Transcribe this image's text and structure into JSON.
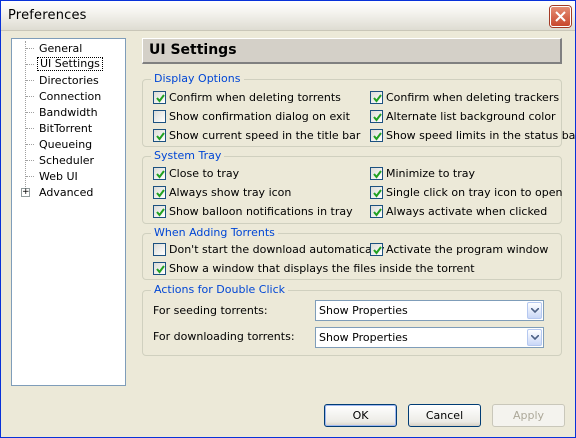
{
  "window": {
    "title": "Preferences"
  },
  "sidebar": {
    "items": [
      {
        "label": "General",
        "selected": false
      },
      {
        "label": "UI Settings",
        "selected": true
      },
      {
        "label": "Directories",
        "selected": false
      },
      {
        "label": "Connection",
        "selected": false
      },
      {
        "label": "Bandwidth",
        "selected": false
      },
      {
        "label": "BitTorrent",
        "selected": false
      },
      {
        "label": "Queueing",
        "selected": false
      },
      {
        "label": "Scheduler",
        "selected": false
      },
      {
        "label": "Web UI",
        "selected": false
      },
      {
        "label": "Advanced",
        "selected": false,
        "expander": "+"
      }
    ]
  },
  "panel": {
    "title": "UI Settings"
  },
  "display_options": {
    "legend": "Display Options",
    "items": [
      {
        "label": "Confirm when deleting torrents",
        "checked": true
      },
      {
        "label": "Confirm when deleting trackers",
        "checked": true
      },
      {
        "label": "Show confirmation dialog on exit",
        "checked": false
      },
      {
        "label": "Alternate list background color",
        "checked": true
      },
      {
        "label": "Show current speed in the title bar",
        "checked": true
      },
      {
        "label": "Show speed limits in the status bar",
        "checked": true
      }
    ]
  },
  "system_tray": {
    "legend": "System Tray",
    "items": [
      {
        "label": "Close to tray",
        "checked": true
      },
      {
        "label": "Minimize to tray",
        "checked": true
      },
      {
        "label": "Always show tray icon",
        "checked": true
      },
      {
        "label": "Single click on tray icon to open",
        "checked": true
      },
      {
        "label": "Show balloon notifications in tray",
        "checked": true
      },
      {
        "label": "Always activate when clicked",
        "checked": true
      }
    ]
  },
  "adding_torrents": {
    "legend": "When Adding Torrents",
    "items": [
      {
        "label": "Don't start the download automatically",
        "checked": false
      },
      {
        "label": "Activate the program window",
        "checked": true
      },
      {
        "label": "Show a window that displays the files inside the torrent",
        "checked": true
      }
    ]
  },
  "double_click": {
    "legend": "Actions for Double Click",
    "seeding_label": "For seeding torrents:",
    "seeding_value": "Show Properties",
    "downloading_label": "For downloading torrents:",
    "downloading_value": "Show Properties"
  },
  "buttons": {
    "ok": "OK",
    "cancel": "Cancel",
    "apply": "Apply"
  },
  "colors": {
    "legend_blue": "#0046d5",
    "check_green": "#21a121",
    "window_bg": "#ece9d8"
  }
}
